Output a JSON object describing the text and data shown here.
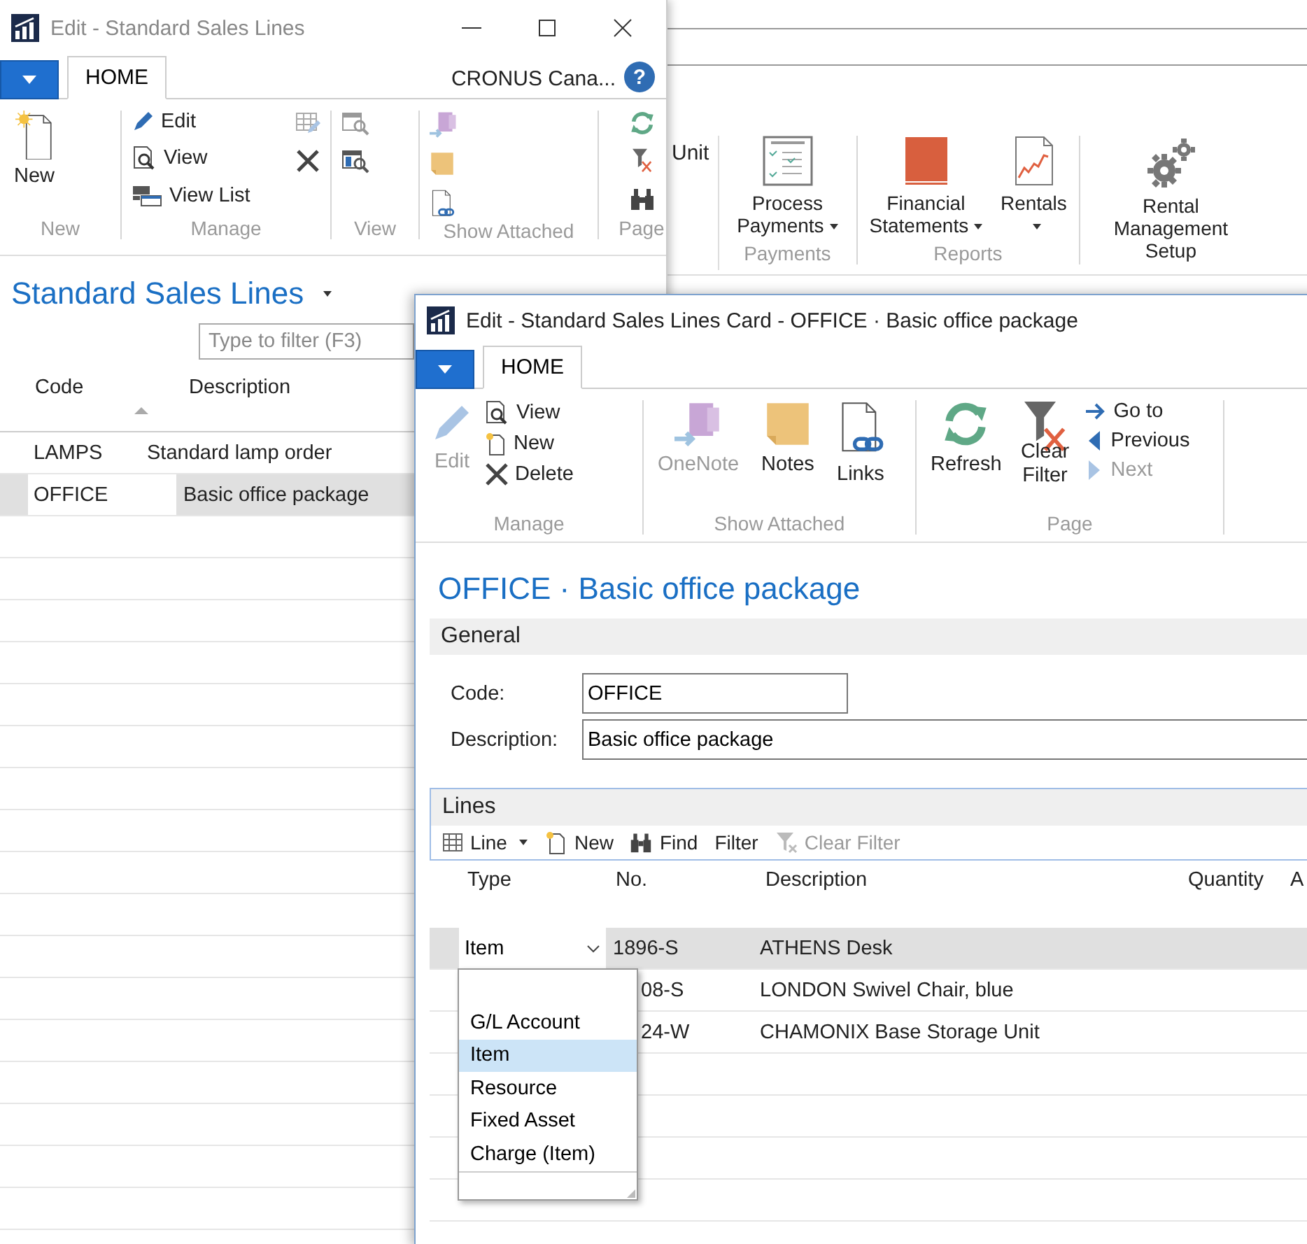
{
  "background_window": {
    "cut_label": "Unit",
    "groups": [
      {
        "label": "Payments",
        "actions": [
          {
            "label": "Process Payments",
            "dropdown": true
          }
        ]
      },
      {
        "label": "Reports",
        "actions": [
          {
            "label": "Financial Statements",
            "dropdown": true
          },
          {
            "label": "Rentals",
            "dropdown": true
          }
        ]
      },
      {
        "actions": [
          {
            "label": "Rental Management Setup",
            "dropdown": false
          }
        ]
      }
    ]
  },
  "list_window": {
    "title": "Edit - Standard Sales Lines",
    "tab": {
      "label": "HOME",
      "selected": true
    },
    "company": "CRONUS Cana...",
    "help": "?",
    "groups": [
      {
        "label": "New",
        "actions": [
          {
            "label": "New"
          }
        ]
      },
      {
        "label": "Manage",
        "actions": [
          {
            "label": "Edit"
          },
          {
            "label": "View"
          },
          {
            "label": "View List"
          }
        ]
      },
      {
        "label": "View"
      },
      {
        "label": "Show Attached"
      },
      {
        "label": "Page"
      }
    ],
    "page_title": "Standard Sales Lines",
    "filter": {
      "placeholder": "Type to filter (F3)"
    },
    "columns": [
      {
        "label": "Code",
        "sorted": true
      },
      {
        "label": "Description",
        "sorted": false
      }
    ],
    "rows": [
      {
        "cells": [
          "LAMPS",
          "Standard lamp order"
        ],
        "selected": false
      },
      {
        "cells": [
          "OFFICE",
          "Basic office package"
        ],
        "selected": true
      }
    ]
  },
  "card_window": {
    "title": "Edit - Standard Sales Lines Card - OFFICE · Basic office package",
    "tab": {
      "label": "HOME",
      "selected": true
    },
    "groups": [
      {
        "label": "Manage",
        "actions": [
          {
            "label": "Edit",
            "disabled": true
          },
          {
            "label": "View",
            "disabled": false
          },
          {
            "label": "New",
            "disabled": false
          },
          {
            "label": "Delete",
            "disabled": false
          }
        ]
      },
      {
        "label": "Show Attached",
        "actions": [
          {
            "label": "OneNote",
            "disabled": true
          },
          {
            "label": "Notes",
            "disabled": false
          },
          {
            "label": "Links",
            "disabled": false
          }
        ]
      },
      {
        "label": "Page",
        "actions": [
          {
            "label": "Refresh",
            "disabled": false
          },
          {
            "label": "Clear Filter",
            "disabled": false
          },
          {
            "label": "Go to",
            "disabled": false
          },
          {
            "label": "Previous",
            "disabled": false
          },
          {
            "label": "Next",
            "disabled": true
          }
        ]
      }
    ],
    "page_title": "OFFICE · Basic office package",
    "general": {
      "header": "General",
      "fields": [
        {
          "label": "Code:",
          "value": "OFFICE"
        },
        {
          "label": "Description:",
          "value": "Basic office package"
        }
      ]
    },
    "lines": {
      "header": "Lines",
      "toolbar": [
        {
          "label": "Line",
          "dropdown": true,
          "disabled": false
        },
        {
          "label": "New",
          "dropdown": false,
          "disabled": false
        },
        {
          "label": "Find",
          "dropdown": false,
          "disabled": false
        },
        {
          "label": "Filter",
          "dropdown": false,
          "disabled": false
        },
        {
          "label": "Clear Filter",
          "dropdown": false,
          "disabled": true
        }
      ],
      "columns": [
        "Type",
        "No.",
        "Description",
        "Quantity",
        "A"
      ],
      "rows": [
        {
          "type": "Item",
          "no": "1896-S",
          "description": "ATHENS Desk",
          "selected": true,
          "editing": true,
          "no_partly_hidden": false
        },
        {
          "no": "08-S",
          "description": "LONDON Swivel Chair, blue",
          "selected": false,
          "no_partly_hidden": true
        },
        {
          "no": "24-W",
          "description": "CHAMONIX Base Storage Unit",
          "selected": false,
          "no_partly_hidden": true
        }
      ],
      "type_list": {
        "options": [
          {
            "label": "G/L Account",
            "selected": false
          },
          {
            "label": "Item",
            "selected": true
          },
          {
            "label": "Resource",
            "selected": false
          },
          {
            "label": "Fixed Asset",
            "selected": false
          },
          {
            "label": "Charge (Item)",
            "selected": false
          }
        ]
      }
    }
  }
}
